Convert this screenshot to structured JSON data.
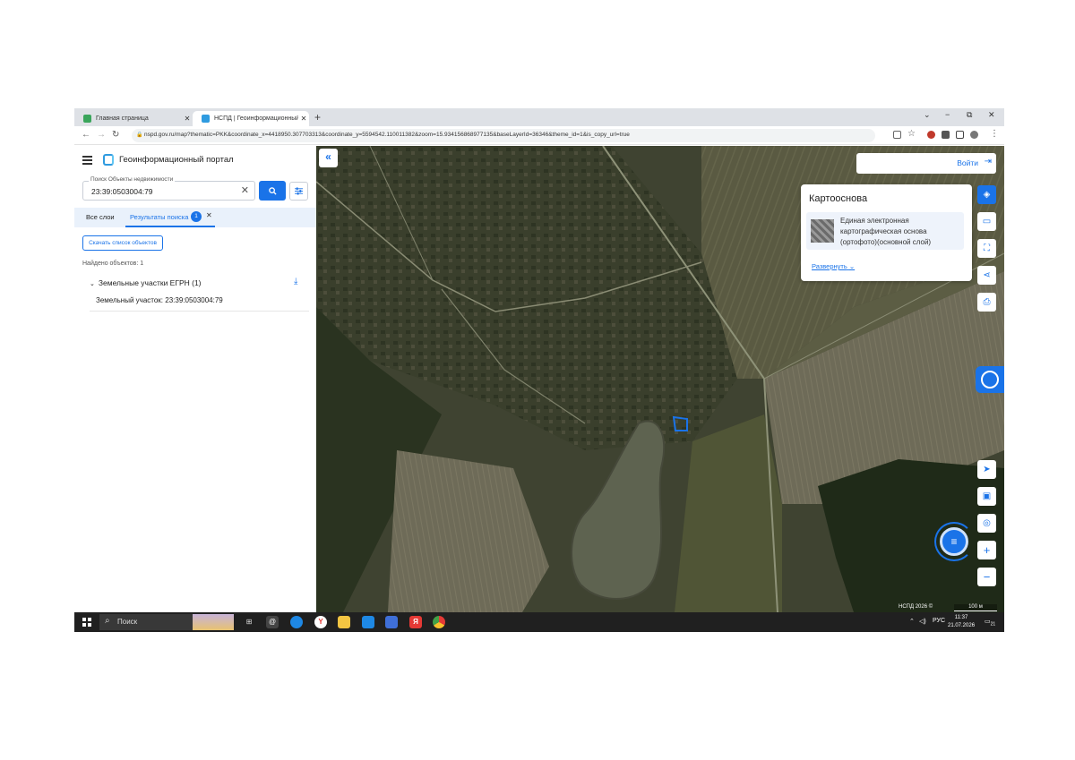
{
  "browser": {
    "tabs": [
      {
        "title": "Главная страница",
        "close": "✕"
      },
      {
        "title": "НСПД | Геоинформационный",
        "close": "✕"
      }
    ],
    "new_tab": "+",
    "window_controls": [
      "⌄",
      "−",
      "⧉",
      "✕"
    ],
    "url": "nspd.gov.ru/map?thematic=PKK&coordinate_x=4418950.307703313&coordinate_y=5594542.110011382&zoom=15.934156868977135&baseLayerId=36346&theme_id=1&is_copy_url=true"
  },
  "sidebar": {
    "portal_title": "Геоинформационный портал",
    "search": {
      "placeholder": "Поиск Объекты недвижимости",
      "value": "23:39:0503004:79"
    },
    "tabs": {
      "all_layers": "Все слои",
      "results": "Результаты поиска",
      "results_count": "1"
    },
    "download_button": "Скачать список объектов",
    "found_count": "Найдено объектов: 1",
    "group_title": "Земельные участки ЕГРН (1)",
    "item": "Земельный участок: 23:39:0503004:79"
  },
  "map": {
    "login_label": "Войти",
    "basemap_panel": {
      "title": "Картооснова",
      "layer_name": "Единая электронная картографическая основа (ортофото)(основной слой)",
      "expand_label": "Развернуть"
    },
    "attribution": "НСПД 2026 ©",
    "scale": "100 м",
    "accent_color": "#1a73e8"
  },
  "taskbar": {
    "search_label": "Поиск",
    "language": "РУС",
    "time": "11:37",
    "date": "21.07.2026",
    "notifications": "21"
  }
}
